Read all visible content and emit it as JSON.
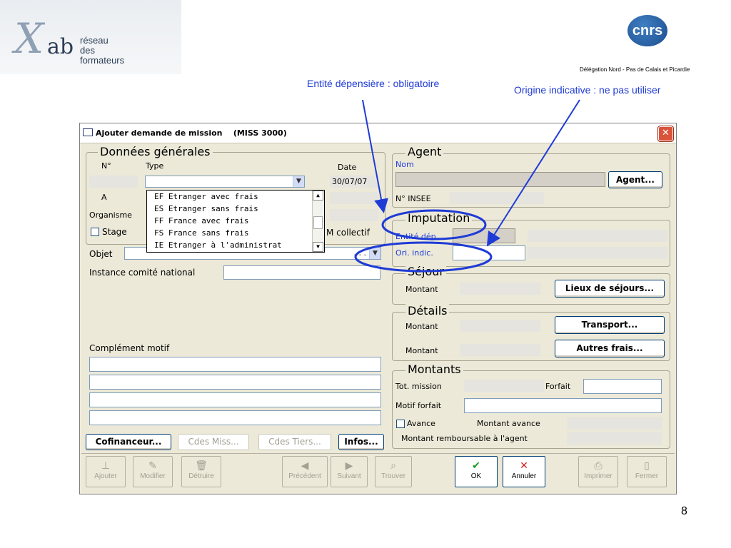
{
  "slide": {
    "logo_left_line1": "réseau",
    "logo_left_line2": "des formateurs",
    "logo_left_brand": "ab",
    "logo_right_text": "cnrs",
    "delegation": "Délégation Nord - Pas de Calais et Picardie",
    "annotation_1": "Entité dépensière : obligatoire",
    "annotation_2": "Origine indicative : ne pas utiliser",
    "page_number": "8",
    "annotation_color": "#1f3bd6"
  },
  "window": {
    "title": "Ajouter demande de mission    (MISS 3000)",
    "close_glyph": "✕"
  },
  "general": {
    "group_title": "Données générales",
    "num_label": "N°",
    "type_label": "Type",
    "date_label": "Date",
    "date_value": "30/07/07",
    "a_label": "A",
    "organisme_label": "Organisme",
    "stage_label": "Stage",
    "collectif_label": "M collectif",
    "objet_label": "Objet",
    "objet_dots": ". . .",
    "instance_label": "Instance comité national",
    "complement_label": "Complément motif",
    "type_options": [
      "EF Etranger avec frais",
      "ES Etranger sans frais",
      "FF France avec frais",
      "FS France sans frais",
      "IE Etranger à l'administrat"
    ]
  },
  "agent": {
    "group_title": "Agent",
    "nom_label": "Nom",
    "agent_button": "Agent...",
    "insee_label": "N° INSEE"
  },
  "imputation": {
    "group_title": "Imputation",
    "entite_label": "Entité dép.",
    "origine_label": "Ori. indic."
  },
  "sejour": {
    "group_title": "Séjour",
    "montant_label": "Montant",
    "lieux_button": "Lieux de séjours..."
  },
  "details": {
    "group_title": "Détails",
    "montant_label_1": "Montant",
    "transport_button": "Transport...",
    "montant_label_2": "Montant",
    "autres_button": "Autres frais..."
  },
  "montants": {
    "group_title": "Montants",
    "tot_mission_label": "Tot. mission",
    "forfait_label": "Forfait",
    "motif_forfait_label": "Motif forfait",
    "avance_label": "Avance",
    "montant_avance_label": "Montant avance",
    "remboursable_label": "Montant remboursable à l'agent"
  },
  "bottom_buttons": {
    "cofinanceur": "Cofinanceur...",
    "cdes_miss": "Cdes Miss...",
    "cdes_tiers": "Cdes Tiers...",
    "infos": "Infos..."
  },
  "toolbar": {
    "ajouter": "Ajouter",
    "modifier": "Modifier",
    "detruire": "Détruire",
    "precedent": "Précédent",
    "suivant": "Suivant",
    "trouver": "Trouver",
    "ok": "OK",
    "annuler": "Annuler",
    "imprimer": "Imprimer",
    "fermer": "Fermer"
  }
}
